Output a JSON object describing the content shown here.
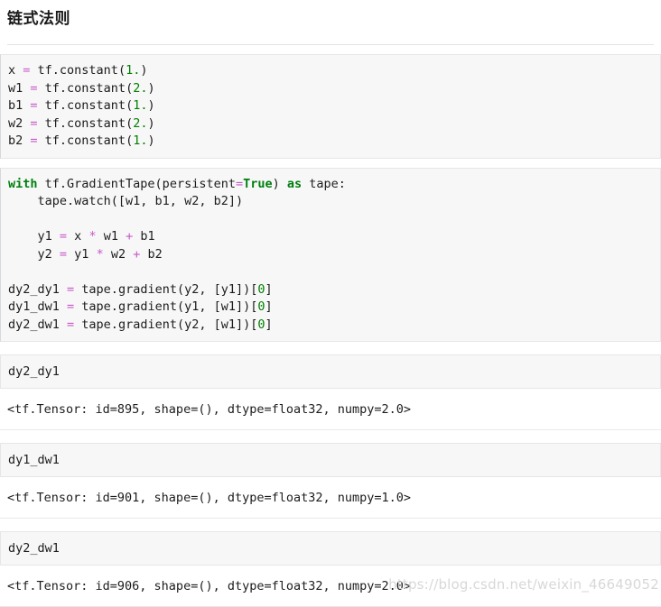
{
  "page": {
    "title": "链式法则",
    "watermark": "https://blog.csdn.net/weixin_46649052"
  },
  "colors": {
    "operator": "#c857c8",
    "number": "#008000",
    "keyword": "#007f0e",
    "plain": "#1c1c1c",
    "code_bg": "#f7f7f7",
    "code_border": "#e6e6e6",
    "watermark": "#d8d8d8"
  },
  "cells": [
    {
      "type": "code",
      "name": "code-cell-constants",
      "lines": [
        [
          {
            "t": "x ",
            "c": "plain"
          },
          {
            "t": "=",
            "c": "op"
          },
          {
            "t": " tf.constant(",
            "c": "plain"
          },
          {
            "t": "1.",
            "c": "num"
          },
          {
            "t": ")",
            "c": "plain"
          }
        ],
        [
          {
            "t": "w1 ",
            "c": "plain"
          },
          {
            "t": "=",
            "c": "op"
          },
          {
            "t": " tf.constant(",
            "c": "plain"
          },
          {
            "t": "2.",
            "c": "num"
          },
          {
            "t": ")",
            "c": "plain"
          }
        ],
        [
          {
            "t": "b1 ",
            "c": "plain"
          },
          {
            "t": "=",
            "c": "op"
          },
          {
            "t": " tf.constant(",
            "c": "plain"
          },
          {
            "t": "1.",
            "c": "num"
          },
          {
            "t": ")",
            "c": "plain"
          }
        ],
        [
          {
            "t": "w2 ",
            "c": "plain"
          },
          {
            "t": "=",
            "c": "op"
          },
          {
            "t": " tf.constant(",
            "c": "plain"
          },
          {
            "t": "2.",
            "c": "num"
          },
          {
            "t": ")",
            "c": "plain"
          }
        ],
        [
          {
            "t": "b2 ",
            "c": "plain"
          },
          {
            "t": "=",
            "c": "op"
          },
          {
            "t": " tf.constant(",
            "c": "plain"
          },
          {
            "t": "1.",
            "c": "num"
          },
          {
            "t": ")",
            "c": "plain"
          }
        ]
      ]
    },
    {
      "type": "code",
      "name": "code-cell-gradienttape",
      "lines": [
        [
          {
            "t": "with",
            "c": "kw"
          },
          {
            "t": " tf.GradientTape(persistent",
            "c": "plain"
          },
          {
            "t": "=",
            "c": "op"
          },
          {
            "t": "True",
            "c": "kw"
          },
          {
            "t": ") ",
            "c": "plain"
          },
          {
            "t": "as",
            "c": "kw"
          },
          {
            "t": " tape:",
            "c": "plain"
          }
        ],
        [
          {
            "t": "    tape.watch([w1, b1, w2, b2])",
            "c": "plain"
          }
        ],
        [],
        [
          {
            "t": "    y1 ",
            "c": "plain"
          },
          {
            "t": "=",
            "c": "op"
          },
          {
            "t": " x ",
            "c": "plain"
          },
          {
            "t": "*",
            "c": "op"
          },
          {
            "t": " w1 ",
            "c": "plain"
          },
          {
            "t": "+",
            "c": "op"
          },
          {
            "t": " b1",
            "c": "plain"
          }
        ],
        [
          {
            "t": "    y2 ",
            "c": "plain"
          },
          {
            "t": "=",
            "c": "op"
          },
          {
            "t": " y1 ",
            "c": "plain"
          },
          {
            "t": "*",
            "c": "op"
          },
          {
            "t": " w2 ",
            "c": "plain"
          },
          {
            "t": "+",
            "c": "op"
          },
          {
            "t": " b2",
            "c": "plain"
          }
        ],
        [],
        [
          {
            "t": "dy2_dy1 ",
            "c": "plain"
          },
          {
            "t": "=",
            "c": "op"
          },
          {
            "t": " tape.gradient(y2, [y1])[",
            "c": "plain"
          },
          {
            "t": "0",
            "c": "num"
          },
          {
            "t": "]",
            "c": "plain"
          }
        ],
        [
          {
            "t": "dy1_dw1 ",
            "c": "plain"
          },
          {
            "t": "=",
            "c": "op"
          },
          {
            "t": " tape.gradient(y1, [w1])[",
            "c": "plain"
          },
          {
            "t": "0",
            "c": "num"
          },
          {
            "t": "]",
            "c": "plain"
          }
        ],
        [
          {
            "t": "dy2_dw1 ",
            "c": "plain"
          },
          {
            "t": "=",
            "c": "op"
          },
          {
            "t": " tape.gradient(y2, [w1])[",
            "c": "plain"
          },
          {
            "t": "0",
            "c": "num"
          },
          {
            "t": "]",
            "c": "plain"
          }
        ]
      ]
    },
    {
      "type": "output",
      "name": "output-dy2-dy1",
      "label": "dy2_dy1",
      "result": "<tf.Tensor: id=895, shape=(), dtype=float32, numpy=2.0>"
    },
    {
      "type": "output",
      "name": "output-dy1-dw1",
      "label": "dy1_dw1",
      "result": "<tf.Tensor: id=901, shape=(), dtype=float32, numpy=1.0>"
    },
    {
      "type": "output",
      "name": "output-dy2-dw1",
      "label": "dy2_dw1",
      "result": "<tf.Tensor: id=906, shape=(), dtype=float32, numpy=2.0>"
    }
  ]
}
